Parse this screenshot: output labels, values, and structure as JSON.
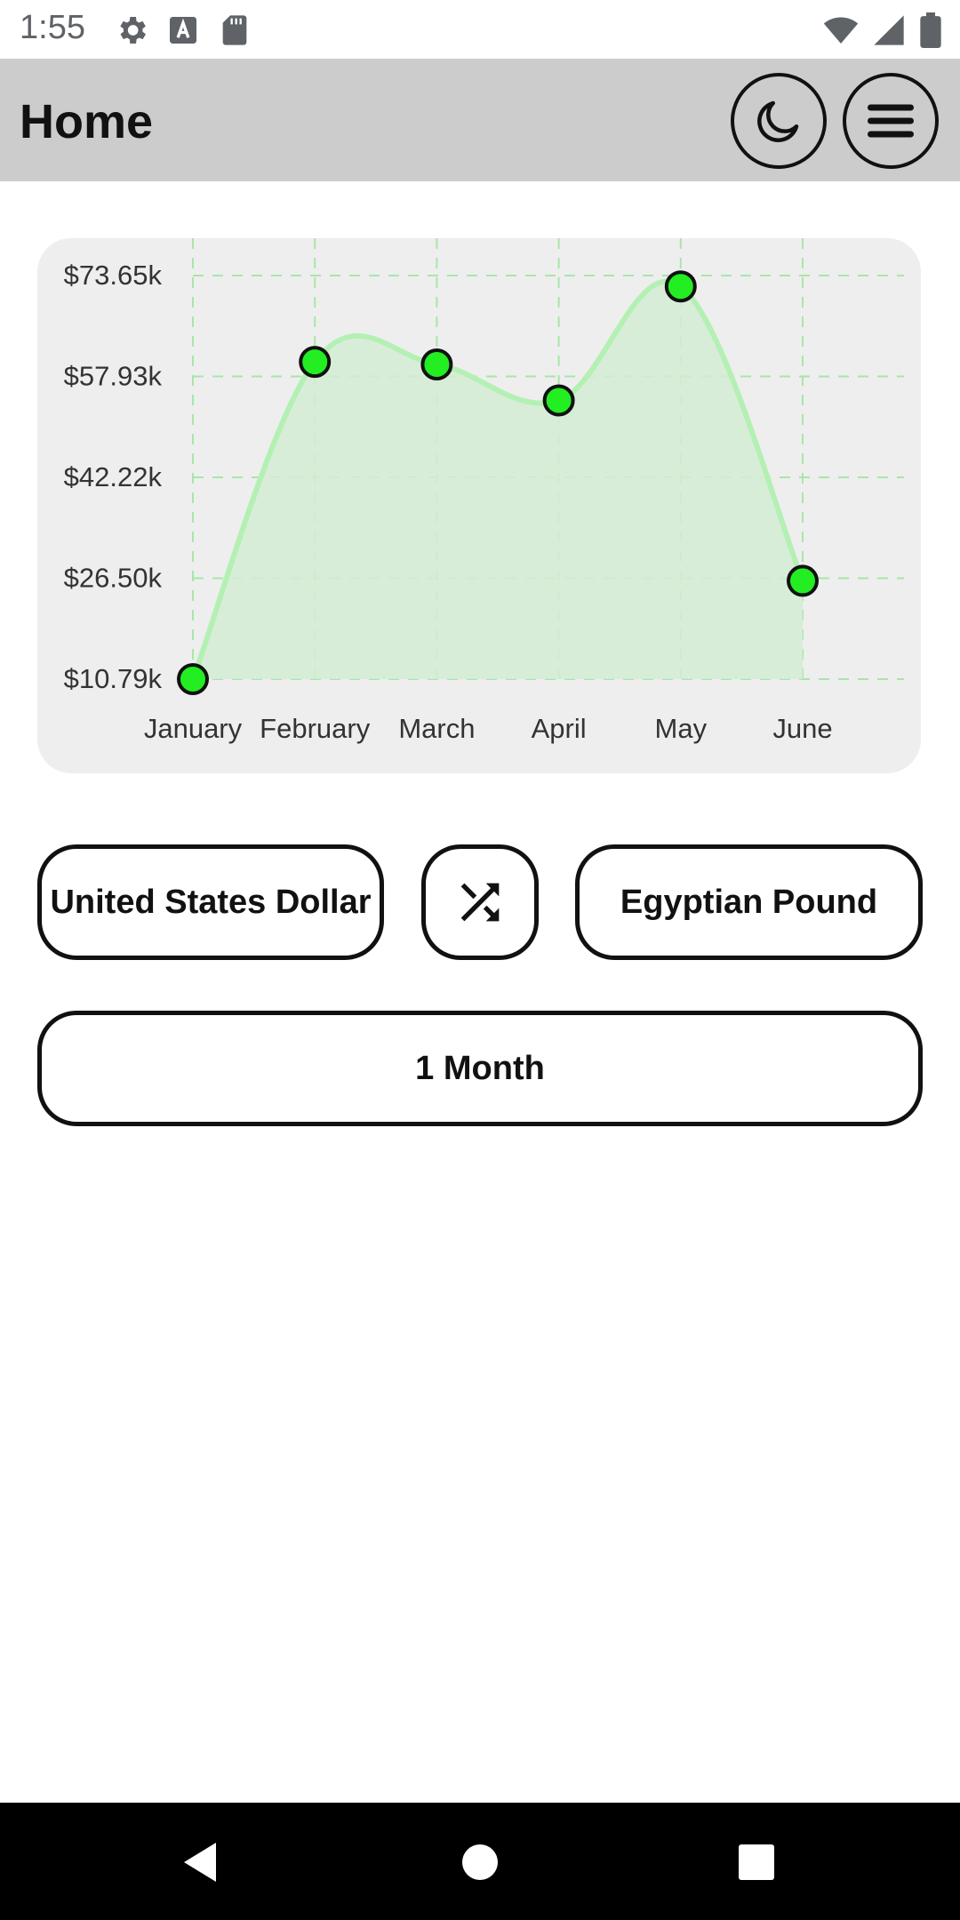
{
  "status_bar": {
    "time": "1:55",
    "left_icons": [
      "gear-icon",
      "keyboard-a-icon",
      "sd-card-icon"
    ],
    "right_icons": [
      "wifi-icon",
      "cell-signal-icon",
      "battery-icon"
    ]
  },
  "app_bar": {
    "title": "Home",
    "theme_button_icon": "moon-icon",
    "menu_button_icon": "hamburger-menu-icon"
  },
  "chart_data": {
    "type": "area",
    "categories": [
      "January",
      "February",
      "March",
      "April",
      "May",
      "June"
    ],
    "values": [
      10.79,
      60.2,
      59.8,
      54.2,
      71.95,
      26.1
    ],
    "y_ticks": [
      "$73.65k",
      "$57.93k",
      "$42.22k",
      "$26.50k",
      "$10.79k"
    ],
    "ylim": [
      10.79,
      73.65
    ],
    "grid": true,
    "line_color": "#b4f0b4",
    "fill_color": "#d4ecd4",
    "point_color": "#22ee22",
    "grid_color": "#a8e6a8"
  },
  "controls": {
    "from_currency": "United States Dollar",
    "swap_icon": "shuffle-icon",
    "to_currency": "Egyptian Pound",
    "period": "1 Month"
  },
  "nav_bar": {
    "icons": [
      "back-triangle-icon",
      "home-circle-icon",
      "recents-square-icon"
    ]
  }
}
